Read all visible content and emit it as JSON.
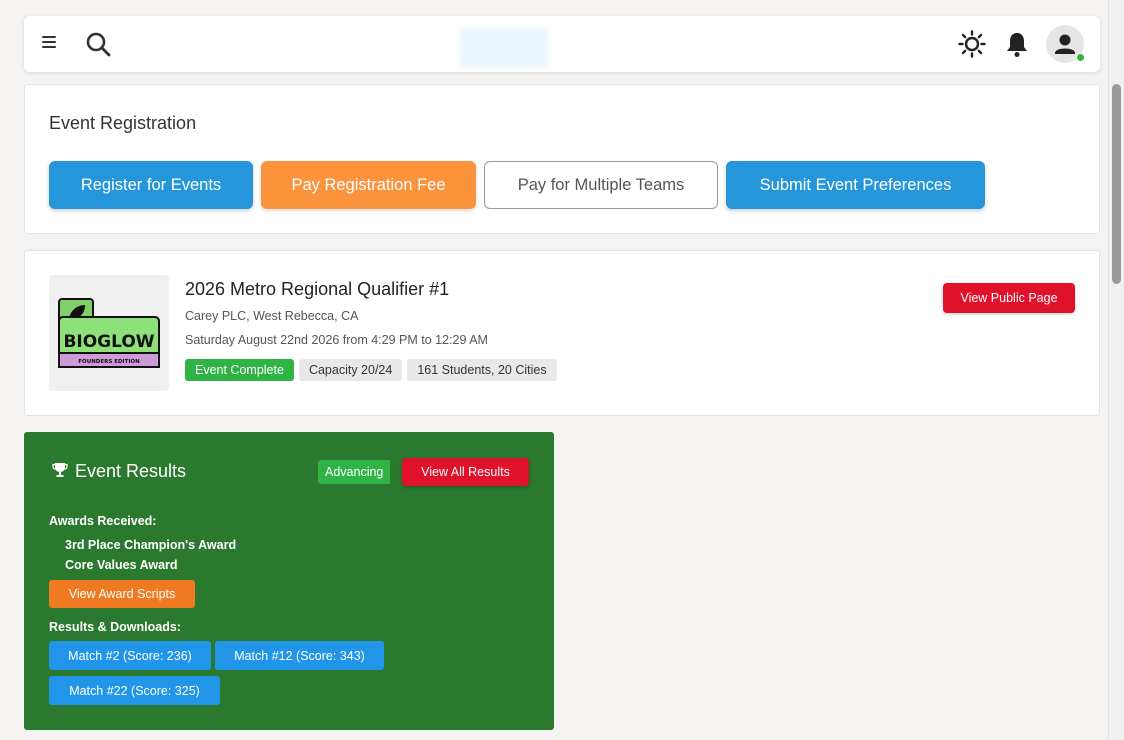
{
  "header": {
    "menu_icon": "hamburger-icon",
    "search_icon": "search-icon",
    "theme_icon": "sun-icon",
    "notification_icon": "bell-icon",
    "avatar_icon": "user-icon",
    "status_color": "#2fb344"
  },
  "registration": {
    "title": "Event Registration",
    "buttons": [
      {
        "label": "Register for Events",
        "color": "#2596d9"
      },
      {
        "label": "Pay Registration Fee",
        "color": "#fb923c"
      },
      {
        "label": "Pay for Multiple Teams",
        "color": "#ffffff"
      },
      {
        "label": "Submit Event Preferences",
        "color": "#2596d9"
      }
    ]
  },
  "event": {
    "logo_text": "BIOGLOW",
    "logo_subtext": "FOUNDERS EDITION",
    "title": "2026 Metro Regional Qualifier #1",
    "location": "Carey PLC, West Rebecca, CA",
    "datetime": "Saturday August 22nd 2026 from 4:29 PM to 12:29 AM",
    "badges": [
      "Event Complete",
      "Capacity 20/24",
      "161 Students, 20 Cities"
    ],
    "public_page_label": "View Public Page"
  },
  "results": {
    "title": "Event Results",
    "status_badge": "Advancing",
    "view_all_label": "View All Results",
    "awards_label": "Awards Received:",
    "awards": [
      "3rd Place Champion's Award",
      "Core Values Award"
    ],
    "award_scripts_label": "View Award Scripts",
    "downloads_label": "Results & Downloads:",
    "matches": [
      "Match #2 (Score: 236)",
      "Match #12 (Score: 343)",
      "Match #22 (Score: 325)"
    ],
    "background_color": "#2b782f"
  }
}
